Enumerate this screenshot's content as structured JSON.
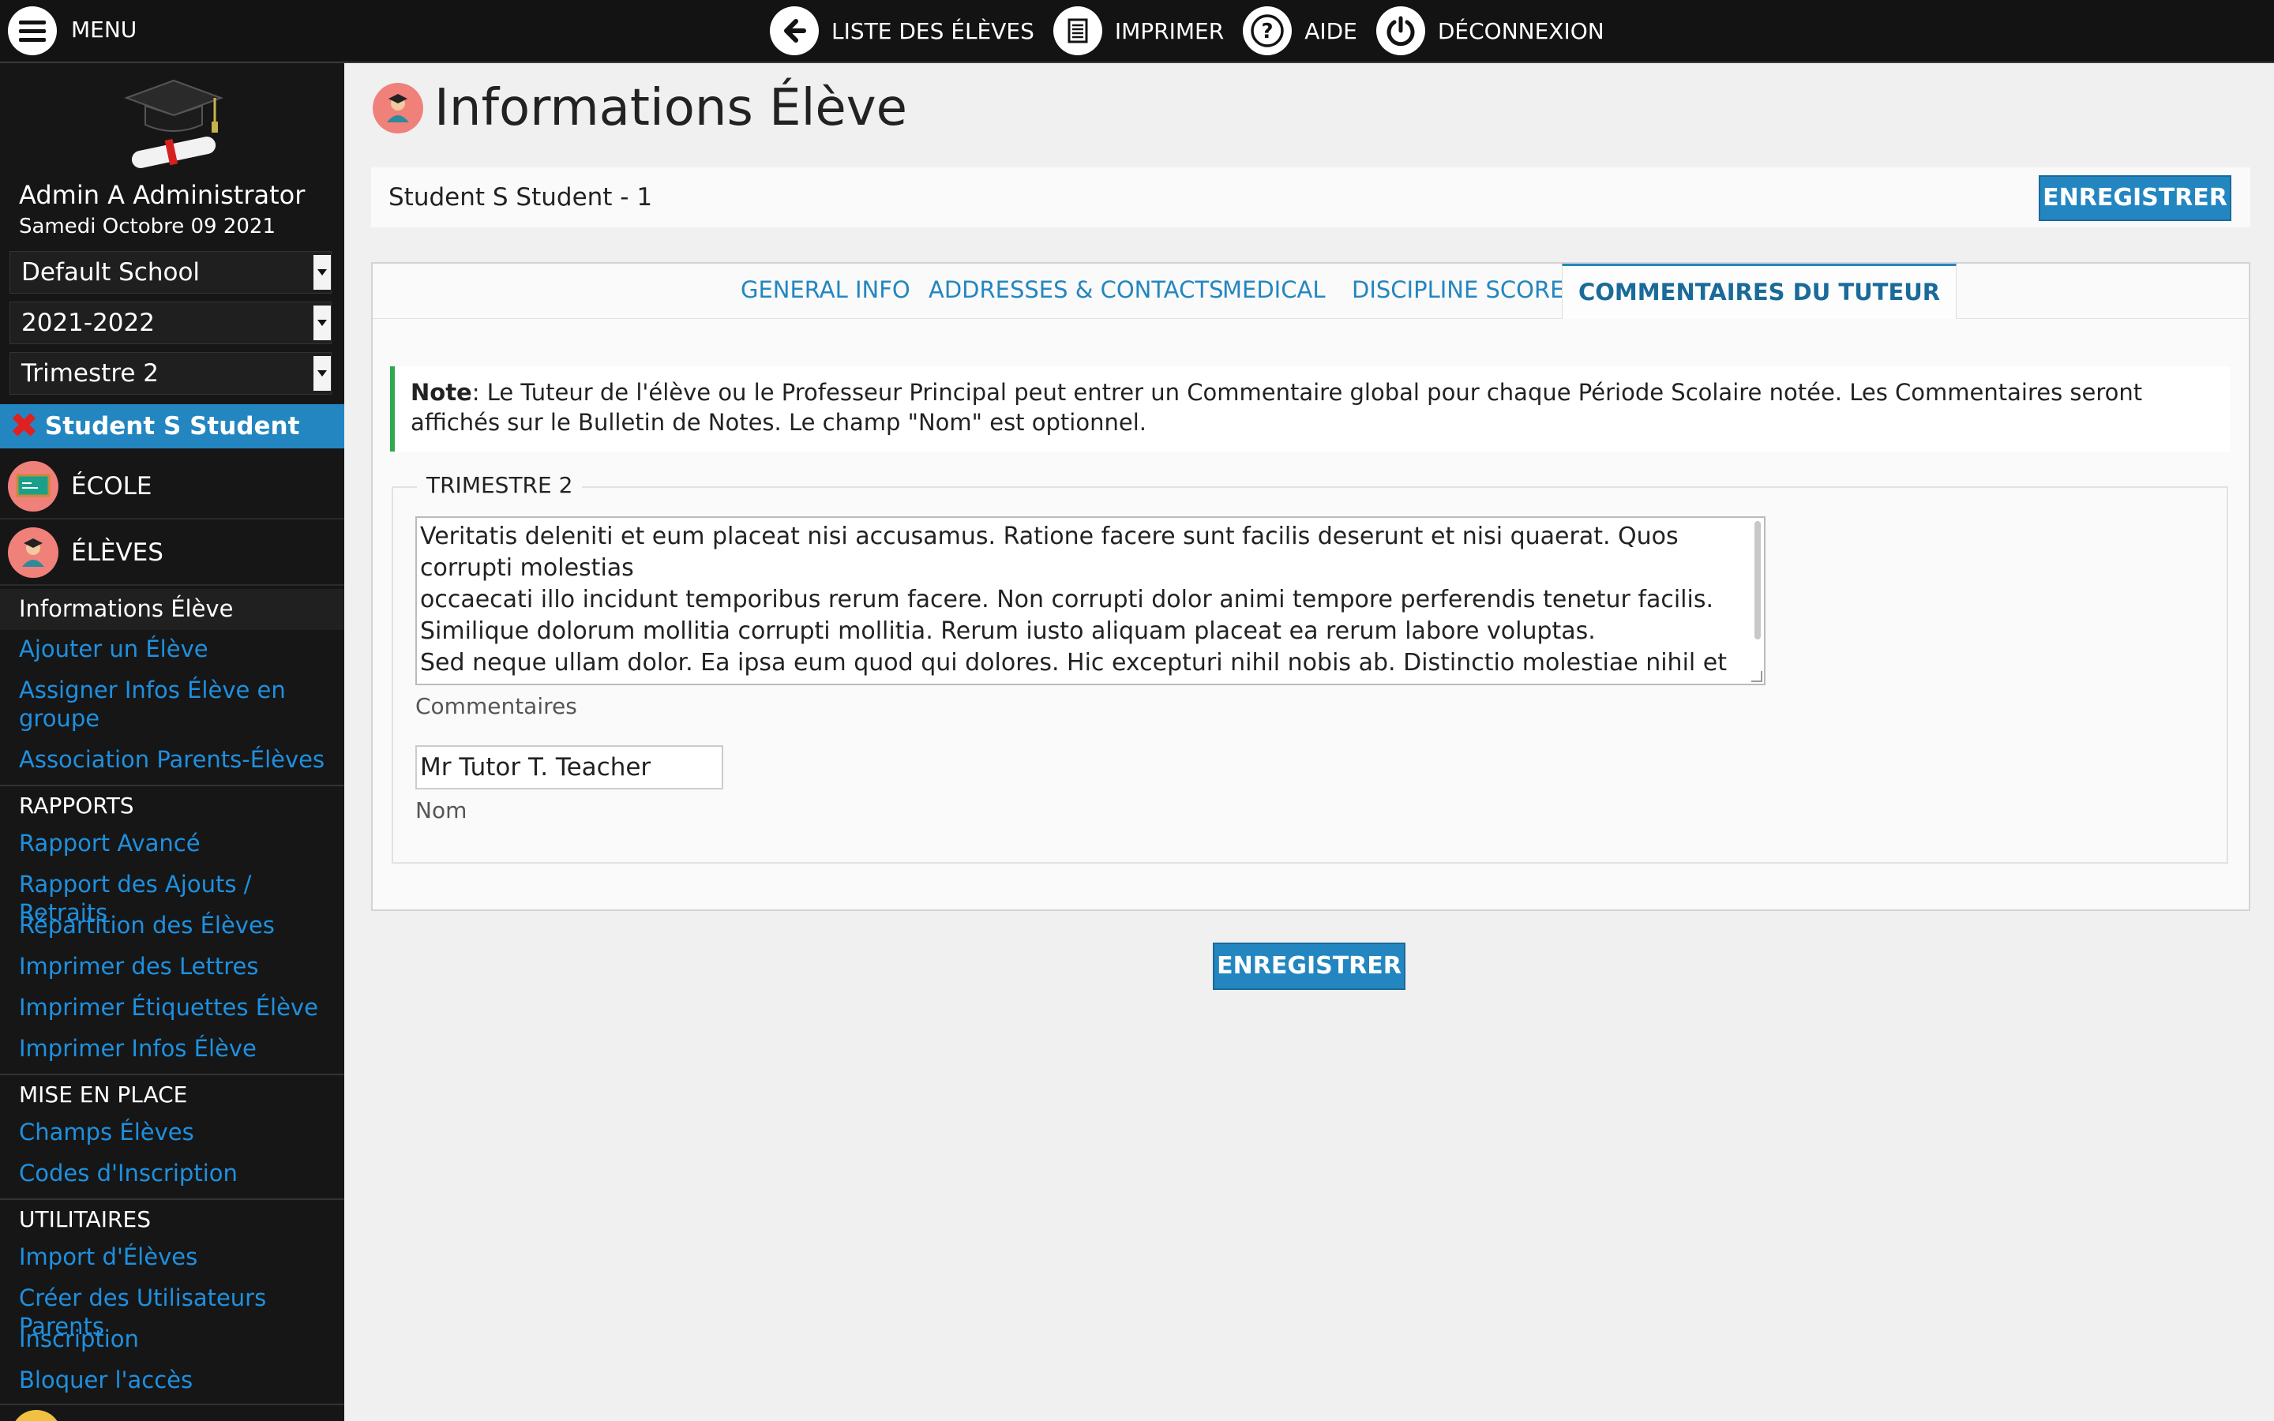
{
  "topbar": {
    "menu_label": "MENU",
    "nav": [
      {
        "label": "LISTE DES ÉLÈVES",
        "icon": "back-arrow-icon"
      },
      {
        "label": "IMPRIMER",
        "icon": "print-icon"
      },
      {
        "label": "AIDE",
        "icon": "help-icon"
      },
      {
        "label": "DÉCONNEXION",
        "icon": "power-icon"
      }
    ]
  },
  "sidebar": {
    "user_name": "Admin A Administrator",
    "date": "Samedi Octobre 09 2021",
    "school_select": "Default School",
    "year_select": "2021-2022",
    "term_select": "Trimestre 2",
    "current_student": "Student S Student",
    "sections": [
      {
        "label": "ÉCOLE",
        "icon": "school-board-icon"
      },
      {
        "label": "ÉLÈVES",
        "icon": "students-icon"
      }
    ],
    "active_item": "Informations Élève",
    "students_links": [
      "Ajouter un Élève",
      "Assigner Infos Élève en groupe",
      "Association Parents-Élèves"
    ],
    "rapports_heading": "RAPPORTS",
    "rapports_links": [
      "Rapport Avancé",
      "Rapport des Ajouts / Retraits",
      "Répartition des Élèves",
      "Imprimer des Lettres",
      "Imprimer Étiquettes Élève",
      "Imprimer Infos Élève"
    ],
    "setup_heading": "MISE EN PLACE",
    "setup_links": [
      "Champs Élèves",
      "Codes d'Inscription"
    ],
    "utils_heading": "UTILITAIRES",
    "utils_links": [
      "Import d'Élèves",
      "Créer des Utilisateurs Parents",
      "Inscription",
      "Bloquer l'accès"
    ]
  },
  "page": {
    "title": "Informations Élève",
    "student_label": "Student S Student - 1",
    "save_label": "ENREGISTRER"
  },
  "tabs": [
    "GENERAL INFO",
    "ADDRESSES & CONTACTS",
    "MEDICAL",
    "DISCIPLINE SCORE",
    "COMMENTAIRES DU TUTEUR"
  ],
  "active_tab": "COMMENTAIRES DU TUTEUR",
  "note": {
    "label": "Note",
    "text": ": Le Tuteur de l'élève ou le Professeur Principal peut entrer un Commentaire global pour chaque Période Scolaire notée. Les Commentaires seront affichés sur le Bulletin de Notes. Le champ \"Nom\" est optionnel."
  },
  "form": {
    "legend": "TRIMESTRE 2",
    "comment_lines": [
      "Veritatis deleniti et eum placeat nisi accusamus. Ratione facere sunt facilis deserunt et nisi quaerat. Quos corrupti molestias",
      "occaecati illo incidunt temporibus rerum facere. Non corrupti dolor animi tempore perferendis tenetur facilis. Similique dolorum mollitia corrupti mollitia. Rerum iusto aliquam placeat ea rerum labore voluptas.",
      "Sed neque ullam dolor. Ea ipsa eum quod qui dolores. Hic excepturi nihil nobis ab. Distinctio molestiae nihil et dolorem"
    ],
    "comment_label": "Commentaires",
    "name_value": "Mr Tutor T. Teacher",
    "name_label": "Nom"
  },
  "colors": {
    "accent": "#2386c0",
    "sidebar_bg": "#161616",
    "topbar_bg": "#131313",
    "note_border": "#2fa84f",
    "link": "#1e90e0"
  }
}
